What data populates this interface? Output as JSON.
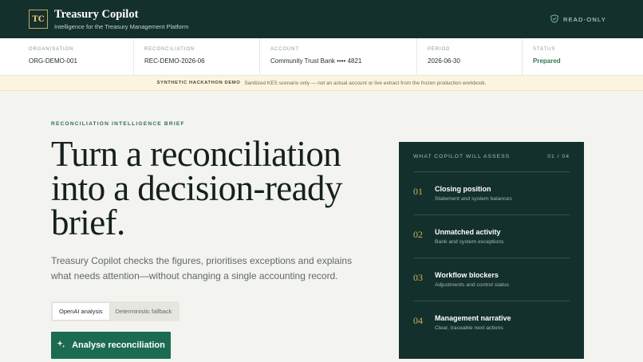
{
  "header": {
    "logo_text": "TC",
    "title": "Treasury Copilot",
    "subtitle": "Intelligence for the Treasury Management Platform",
    "mode_icon": "shield-check-icon",
    "mode_label": "READ-ONLY"
  },
  "meta": {
    "organisation": {
      "label": "ORGANISATION",
      "value": "ORG-DEMO-001"
    },
    "reconciliation": {
      "label": "RECONCILIATION",
      "value": "REC-DEMO-2026-06"
    },
    "account": {
      "label": "ACCOUNT",
      "value": "Community Trust Bank •••• 4821"
    },
    "period": {
      "label": "PERIOD",
      "value": "2026-06-30"
    },
    "status": {
      "label": "STATUS",
      "value": "Prepared"
    }
  },
  "banner": {
    "tag": "SYNTHETIC HACKATHON DEMO",
    "text": "Sanitized KES scenario only — not an actual account or live extract from the frozen production workbook."
  },
  "hero": {
    "eyebrow": "RECONCILIATION INTELLIGENCE BRIEF",
    "title": "Turn a reconciliation into a decision-ready brief.",
    "description": "Treasury Copilot checks the figures, prioritises exceptions and explains what needs attention—without changing a single accounting record.",
    "modes": [
      "OpenAI analysis",
      "Deterministic fallback"
    ],
    "active_mode": "OpenAI analysis",
    "cta_icon": "sparkle-icon",
    "cta_label": "Analyse reconciliation"
  },
  "panel": {
    "heading": "WHAT COPILOT WILL ASSESS",
    "counter": "01 / 04",
    "steps": [
      {
        "num": "01",
        "title": "Closing position",
        "desc": "Statement and system balances"
      },
      {
        "num": "02",
        "title": "Unmatched activity",
        "desc": "Bank and system exceptions"
      },
      {
        "num": "03",
        "title": "Workflow blockers",
        "desc": "Adjustments and control status"
      },
      {
        "num": "04",
        "title": "Management narrative",
        "desc": "Clear, traceable next actions"
      }
    ]
  },
  "colors": {
    "brand_dark": "#14302d",
    "accent_green": "#1b6b52",
    "accent_gold": "#d0ae5e",
    "status_ok": "#2f7a55",
    "banner_bg": "#fbf4df"
  }
}
